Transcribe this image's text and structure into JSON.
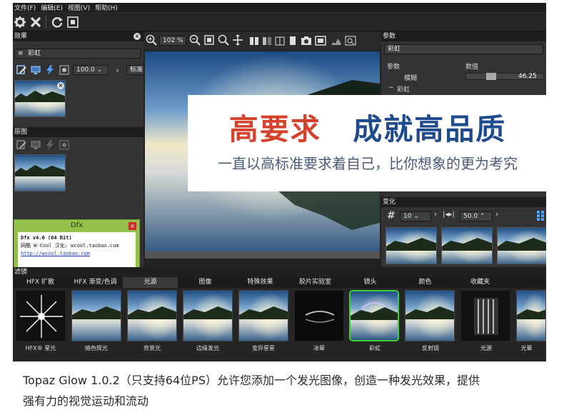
{
  "menu": [
    "文件(F)",
    "编辑(E)",
    "视图(V)",
    "帮助(H)"
  ],
  "toolbar": {
    "zoom": "102 %"
  },
  "effects_panel": {
    "title": "效果",
    "effect_name": "彩虹",
    "opacity": "100.0",
    "blend_mode": "标准"
  },
  "original_panel": {
    "title": "原图"
  },
  "dialog": {
    "title": "Dfx",
    "line1": "Dfx v4.0 (64 Bit)",
    "line2": "网酷 W-Cool 汉化: wcool.taobao.com",
    "link": "http://wcool.taobao.com",
    "button": "关闭"
  },
  "params_panel": {
    "title": "参数",
    "preset": "彩虹",
    "col_param": "参数",
    "col_value": "数值",
    "row1_label": "模糊",
    "row1_value": "46.25",
    "row2_label": "彩虹"
  },
  "variation_panel": {
    "title": "变化",
    "count": "10",
    "amount": "50.0"
  },
  "filters_panel": {
    "title": "滤镜",
    "tabs": [
      "HFX 扩散",
      "HFX 渐变/色调",
      "光源",
      "图像",
      "特殊效果",
      "胶片实验室",
      "镜头",
      "颜色",
      "收藏夹"
    ],
    "active_tab": 2,
    "items": [
      "HFX® 星光",
      "暗色辉光",
      "背景光",
      "边缘发光",
      "变异星星",
      "冰晕",
      "彩虹",
      "反射镜",
      "光源",
      "光晕"
    ],
    "selected_item": 6
  },
  "banner": {
    "headline_red": "高要求",
    "headline_blue": "成就高品质",
    "subline": "一直以高标准要求着自己，比你想象的更为考究"
  },
  "caption": {
    "line1": "Topaz Glow 1.0.2（只支持64位PS）允许您添加一个发光图像，创造一种发光效果，提供",
    "line2": "强有力的视觉运动和流动"
  },
  "colors": {
    "accent_red": "#d6412c",
    "accent_blue": "#1f4a8e",
    "dialog_green": "#94c149",
    "selection_green": "#3fd23a"
  }
}
